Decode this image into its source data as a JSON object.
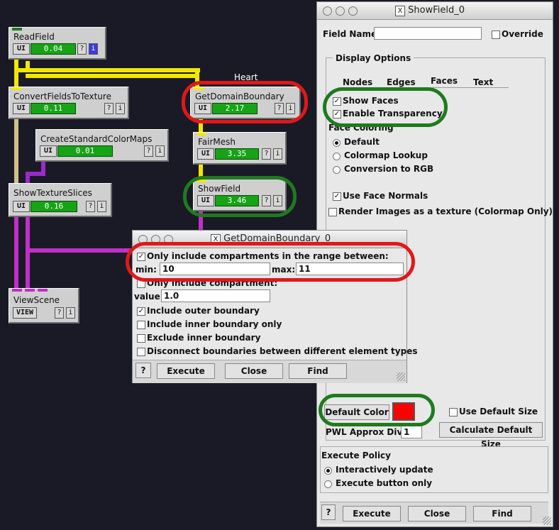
{
  "network": {
    "group_label": "Heart",
    "modules": [
      {
        "name": "ReadField",
        "ui": "UI",
        "time": "0.04",
        "q": "?",
        "i": "i"
      },
      {
        "name": "ConvertFieldsToTexture",
        "ui": "UI",
        "time": "0.11",
        "q": "?",
        "i": "i"
      },
      {
        "name": "CreateStandardColorMaps",
        "ui": "UI",
        "time": "0.01",
        "q": "?",
        "i": "i"
      },
      {
        "name": "ShowTextureSlices",
        "ui": "UI",
        "time": "0.16",
        "q": "?",
        "i": "i"
      },
      {
        "name": "ViewScene",
        "ui": "VIEW",
        "time": "",
        "q": "?",
        "i": "i"
      },
      {
        "name": "GetDomainBoundary",
        "ui": "UI",
        "time": "2.17",
        "q": "?",
        "i": "i"
      },
      {
        "name": "FairMesh",
        "ui": "UI",
        "time": "3.35",
        "q": "?",
        "i": "i"
      },
      {
        "name": "ShowField",
        "ui": "UI",
        "time": "3.46",
        "q": "?",
        "i": "i"
      }
    ]
  },
  "showfield": {
    "title": "ShowField_0",
    "x_icon": "X",
    "field_name_label": "Field Name",
    "field_name_value": "",
    "override_label": "Override",
    "display_options_label": "Display Options",
    "tabs": [
      "Nodes",
      "Edges",
      "Faces",
      "Text"
    ],
    "active_tab": "Faces",
    "show_faces": "Show Faces",
    "enable_transparency": "Enable Transparency",
    "face_coloring_label": "Face Coloring",
    "coloring_options": [
      "Default",
      "Colormap Lookup",
      "Conversion to RGB"
    ],
    "use_face_normals": "Use Face Normals",
    "render_images": "Render Images as a texture (Colormap Only)",
    "default_color_button": "Default Color",
    "default_color": "#ff0000",
    "use_default_size": "Use Default Size",
    "pwl_label": "PWL Approx Div:",
    "pwl_value": "1",
    "calculate_default_size": "Calculate Default Size",
    "execute_policy_label": "Execute Policy",
    "policy_options": [
      "Interactively update",
      "Execute button only"
    ],
    "help": "?",
    "execute": "Execute",
    "close": "Close",
    "find": "Find"
  },
  "gdb": {
    "title": "GetDomainBoundary_0",
    "x_icon": "X",
    "range_check": "Only include compartments in the range between:",
    "min_label": "min:",
    "min_value": "10",
    "max_label": "max:",
    "max_value": "11",
    "only_include": "Only include compartment:",
    "value_label": "value:",
    "value_value": "1.0",
    "include_outer": "Include outer boundary",
    "include_inner_only": "Include inner boundary only",
    "exclude_inner": "Exclude inner boundary",
    "disconnect": "Disconnect boundaries between different element types",
    "help": "?",
    "execute": "Execute",
    "close": "Close",
    "find": "Find"
  },
  "colors": {
    "background": "#1a1a26",
    "annotation_red": "#e01818",
    "annotation_green": "#1f7a1f",
    "progress_green": "#16a316"
  }
}
